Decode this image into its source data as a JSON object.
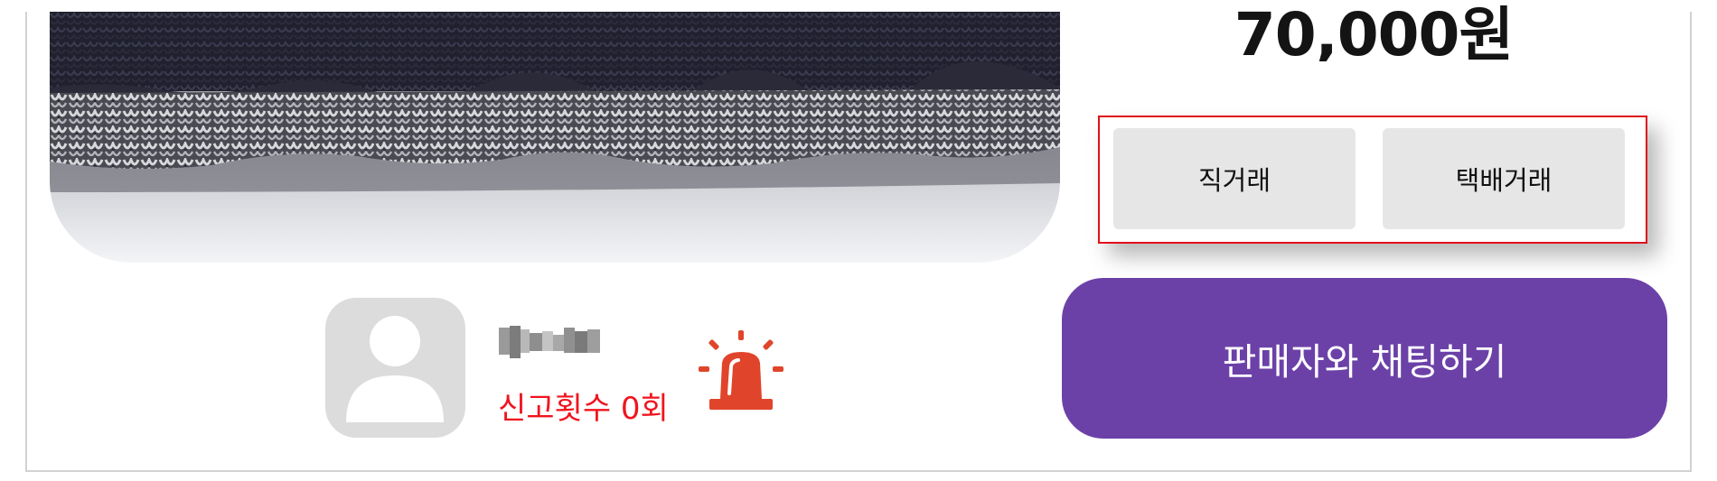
{
  "product": {
    "price": "70,000원"
  },
  "trade_options": {
    "direct_label": "직거래",
    "delivery_label": "택배거래"
  },
  "chat": {
    "label": "판매자와 채팅하기"
  },
  "seller": {
    "report_count_text": "신고횟수 0회"
  },
  "colors": {
    "chat_button": "#6b41a8",
    "report_text": "#f0141e",
    "siren": "#e0452b",
    "trade_box_border": "#e0101a",
    "trade_button_bg": "#e6e6e6"
  },
  "icons": {
    "avatar": "user-placeholder-icon",
    "report": "siren-icon"
  }
}
